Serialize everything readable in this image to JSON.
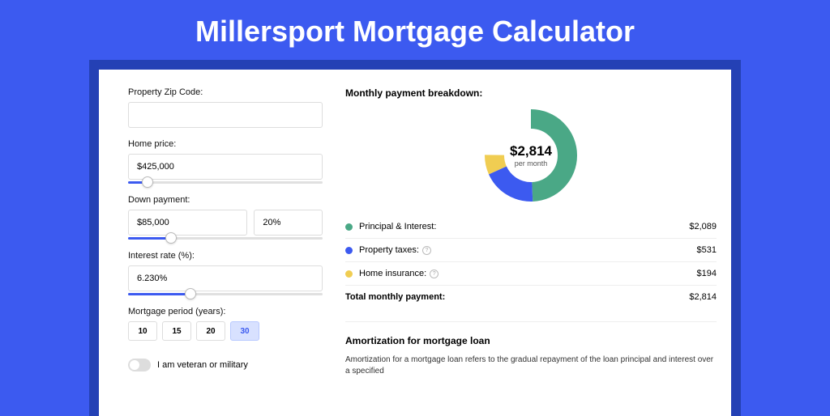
{
  "page": {
    "title": "Millersport Mortgage Calculator"
  },
  "form": {
    "zip": {
      "label": "Property Zip Code:",
      "value": ""
    },
    "home_price": {
      "label": "Home price:",
      "value": "$425,000",
      "slider_pct": 10
    },
    "down_payment": {
      "label": "Down payment:",
      "amount": "$85,000",
      "percent": "20%",
      "slider_pct": 22
    },
    "interest": {
      "label": "Interest rate (%):",
      "value": "6.230%",
      "slider_pct": 32
    },
    "period": {
      "label": "Mortgage period (years):",
      "options": [
        "10",
        "15",
        "20",
        "30"
      ],
      "selected": "30"
    },
    "veteran": {
      "label": "I am veteran or military"
    }
  },
  "breakdown": {
    "title": "Monthly payment breakdown:",
    "center_value": "$2,814",
    "center_sub": "per month",
    "items": [
      {
        "label": "Principal & Interest:",
        "value": "$2,089",
        "color": "#4aa886",
        "help": false
      },
      {
        "label": "Property taxes:",
        "value": "$531",
        "color": "#3C5AF0",
        "help": true
      },
      {
        "label": "Home insurance:",
        "value": "$194",
        "color": "#f0cd52",
        "help": true
      }
    ],
    "total": {
      "label": "Total monthly payment:",
      "value": "$2,814"
    }
  },
  "amort": {
    "title": "Amortization for mortgage loan",
    "text": "Amortization for a mortgage loan refers to the gradual repayment of the loan principal and interest over a specified"
  },
  "chart_data": {
    "type": "pie",
    "title": "Monthly payment breakdown",
    "series": [
      {
        "name": "Principal & Interest",
        "value": 2089,
        "color": "#4aa886"
      },
      {
        "name": "Property taxes",
        "value": 531,
        "color": "#3C5AF0"
      },
      {
        "name": "Home insurance",
        "value": 194,
        "color": "#f0cd52"
      }
    ],
    "total": 2814
  }
}
